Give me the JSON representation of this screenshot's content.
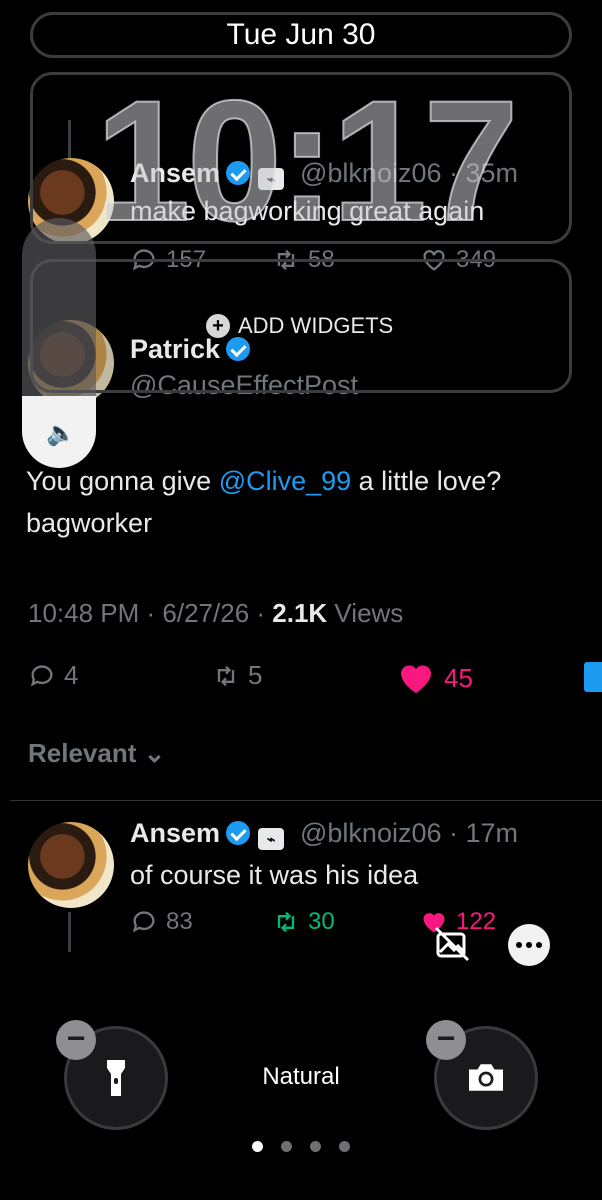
{
  "lock": {
    "date": "Tue Jun 30",
    "time": "10:17",
    "add_widgets": "ADD WIDGETS",
    "filter_name": "Natural",
    "page_dots": 4,
    "active_dot": 0
  },
  "tweet_top": {
    "name": "Ansem",
    "handle": "@blknoiz06",
    "age": "35m",
    "text": "make bagworking great again",
    "replies": "157",
    "retweets": "58",
    "likes": "349"
  },
  "tweet_main": {
    "name": "Patrick",
    "handle": "@CauseEffectPost",
    "text_prefix": "You gonna give ",
    "mention": "@Clive_99",
    "text_suffix": " a little love?",
    "text_line2": "bagworker",
    "time": "10:48 PM",
    "date": "6/27/26",
    "views_count": "2.1K",
    "views_label": "Views",
    "replies": "4",
    "retweets": "5",
    "likes": "45",
    "sort_label": "Relevant"
  },
  "reply": {
    "name": "Ansem",
    "handle": "@blknoiz06",
    "age": "17m",
    "text": "of course it was his idea",
    "replies": "83",
    "retweets": "30",
    "likes": "122"
  },
  "colors": {
    "accent": "#1d9bf0",
    "like": "#f91880",
    "retweet_active": "#00ba7c"
  }
}
